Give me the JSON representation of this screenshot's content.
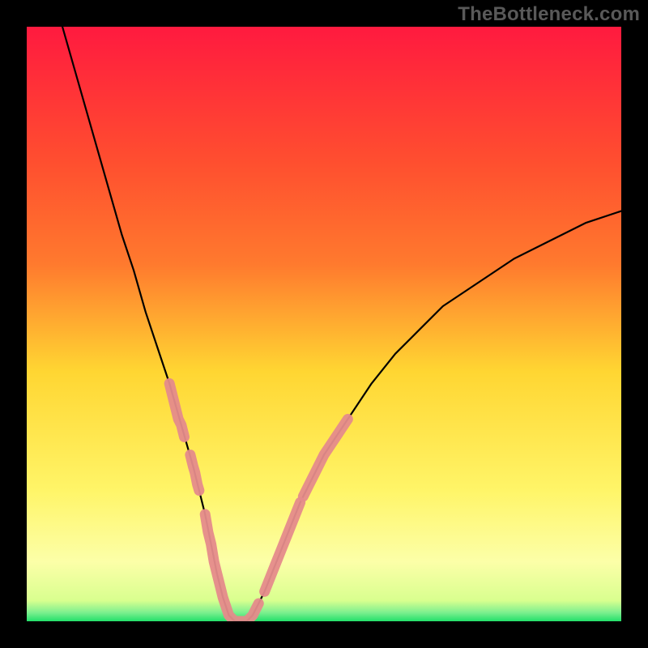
{
  "watermark": "TheBottleneck.com",
  "chart_data": {
    "type": "line",
    "title": "",
    "xlabel": "",
    "ylabel": "",
    "xlim": [
      0,
      100
    ],
    "ylim": [
      0,
      100
    ],
    "background_gradient": {
      "top": "#ff1a3f",
      "mid_upper": "#ff7a2e",
      "mid": "#ffd632",
      "mid_lower": "#fff568",
      "lower_band": "#fcffa8",
      "bottom": "#23e06a"
    },
    "series": [
      {
        "name": "bottleneck-curve",
        "color": "#000000",
        "x": [
          6,
          8,
          10,
          12,
          14,
          16,
          18,
          20,
          22,
          24,
          26,
          28,
          29,
          30,
          31,
          32,
          33,
          34,
          35,
          36,
          37,
          38,
          39,
          40,
          42,
          44,
          46,
          48,
          50,
          54,
          58,
          62,
          66,
          70,
          76,
          82,
          88,
          94,
          100
        ],
        "y": [
          100,
          93,
          86,
          79,
          72,
          65,
          59,
          52,
          46,
          40,
          33,
          26,
          22,
          18,
          13,
          8,
          4,
          1,
          0,
          0,
          0,
          1,
          3,
          5,
          10,
          15,
          20,
          24,
          28,
          34,
          40,
          45,
          49,
          53,
          57,
          61,
          64,
          67,
          69
        ]
      }
    ],
    "highlight_segments": {
      "name": "pink-markers",
      "color": "#e58b8b",
      "description": "thick pink stroke overlays on the curve near the valley and its shoulders",
      "segments": [
        {
          "x": [
            24,
            25,
            25.5,
            26,
            26.5
          ],
          "y": [
            40,
            36,
            34,
            33,
            31
          ]
        },
        {
          "x": [
            27.5,
            28,
            28.3,
            28.7,
            29
          ],
          "y": [
            28,
            26,
            25,
            23,
            22
          ]
        },
        {
          "x": [
            30,
            30.5,
            31,
            31.5,
            32,
            32.5,
            33,
            33.5,
            34,
            34.5,
            35,
            36,
            37,
            38,
            38.5,
            39
          ],
          "y": [
            18,
            15,
            13,
            10,
            8,
            6,
            4,
            2.5,
            1,
            0.5,
            0,
            0,
            0,
            1,
            2,
            3
          ]
        },
        {
          "x": [
            40,
            41,
            42,
            43,
            44,
            45,
            46
          ],
          "y": [
            5,
            7.5,
            10,
            12.5,
            15,
            17.5,
            20
          ]
        },
        {
          "x": [
            46.5,
            47,
            48,
            49,
            50,
            51,
            52,
            53,
            54
          ],
          "y": [
            21,
            22,
            24,
            26,
            28,
            29.5,
            31,
            32.5,
            34
          ]
        }
      ]
    }
  }
}
